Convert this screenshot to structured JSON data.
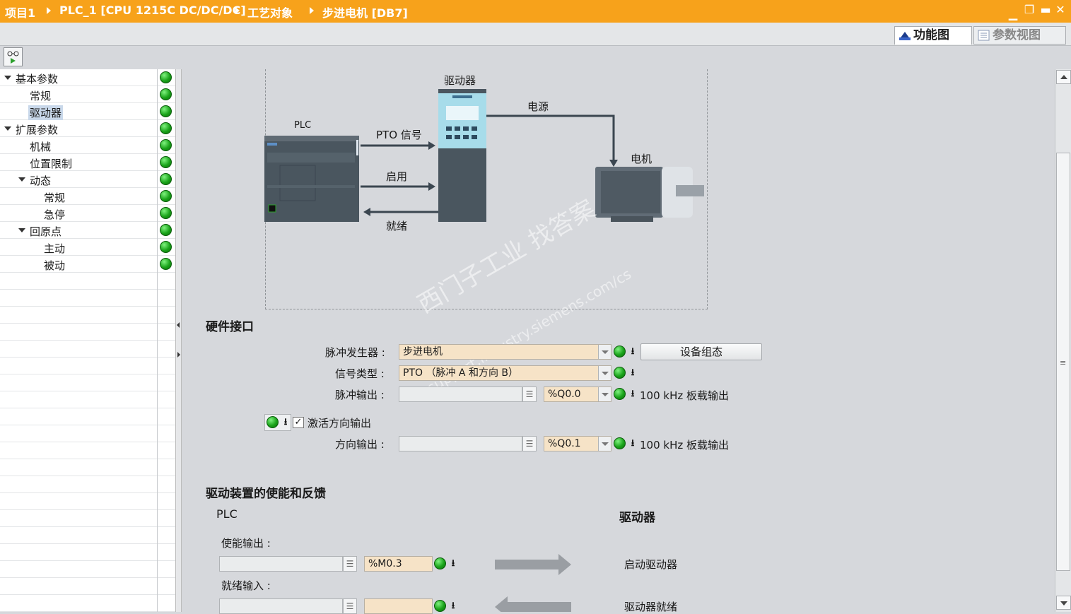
{
  "titlebar": {
    "crumbs": [
      "项目1",
      "PLC_1 [CPU 1215C DC/DC/DC]",
      "工艺对象",
      "步进电机 [DB7]"
    ]
  },
  "view_tabs": {
    "function_view": "功能图",
    "parameter_view": "参数视图"
  },
  "tree": {
    "items": [
      {
        "label": "基本参数",
        "level": 0,
        "expanded": true
      },
      {
        "label": "常规",
        "level": 1
      },
      {
        "label": "驱动器",
        "level": 1,
        "selected": true
      },
      {
        "label": "扩展参数",
        "level": 0,
        "expanded": true
      },
      {
        "label": "机械",
        "level": 1
      },
      {
        "label": "位置限制",
        "level": 1
      },
      {
        "label": "动态",
        "level": 1,
        "expanded": true
      },
      {
        "label": "常规",
        "level": 2
      },
      {
        "label": "急停",
        "level": 2
      },
      {
        "label": "回原点",
        "level": 1,
        "expanded": true
      },
      {
        "label": "主动",
        "level": 2
      },
      {
        "label": "被动",
        "level": 2
      }
    ]
  },
  "diagram": {
    "plc": "PLC",
    "drive": "驱动器",
    "power": "电源",
    "motor": "电机",
    "pto_signal": "PTO 信号",
    "enable": "启用",
    "ready": "就绪"
  },
  "hardware": {
    "title": "硬件接口",
    "pulse_generator_label": "脉冲发生器 :",
    "pulse_generator_value": "步进电机",
    "device_config_button": "设备组态",
    "signal_type_label": "信号类型 :",
    "signal_type_value": "PTO （脉冲 A 和方向 B）",
    "pulse_output_label": "脉冲输出 :",
    "pulse_output_value": "%Q0.0",
    "pulse_output_note": "100 kHz 板载输出",
    "activate_dir_label": "激活方向输出",
    "activate_dir_checked": true,
    "dir_output_label": "方向输出 :",
    "dir_output_value": "%Q0.1",
    "dir_output_note": "100 kHz 板载输出"
  },
  "drive_signals": {
    "title": "驱动装置的使能和反馈",
    "plc_header": "PLC",
    "drive_header": "驱动器",
    "enable_output_label": "使能输出 :",
    "enable_output_value": "%M0.3",
    "enable_target": "启动驱动器",
    "ready_input_label": "就绪输入 :",
    "ready_input_value": "",
    "ready_source": "驱动器就绪"
  },
  "watermark": {
    "line1": "西门子工业  找答案",
    "line2": "support.industry.siemens.com/cs"
  },
  "colors": {
    "titlebar": "#f7a21b",
    "status_ok": "#1aa31a",
    "combo_bg": "#f6e3c7"
  }
}
